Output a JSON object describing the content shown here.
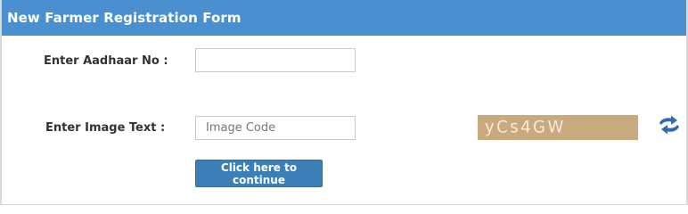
{
  "form": {
    "title": "New Farmer Registration Form",
    "aadhaar": {
      "label": "Enter Aadhaar No :",
      "value": "",
      "placeholder": ""
    },
    "image_text": {
      "label": "Enter Image Text :",
      "value": "",
      "placeholder": "Image Code"
    },
    "captcha": {
      "text": "yCs4GW",
      "background_color": "#c9a97e"
    },
    "refresh_icon": "refresh-icon",
    "continue_button": "Click here to continue"
  },
  "colors": {
    "header": "#4a8fd0",
    "button": "#3a7fb8",
    "refresh_icon": "#2f6db0"
  }
}
